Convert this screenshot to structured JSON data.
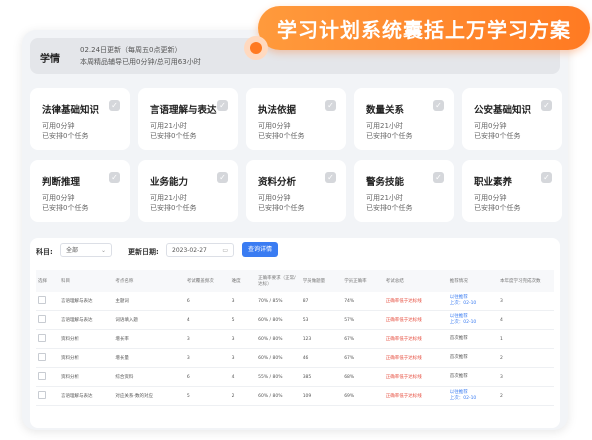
{
  "banner": {
    "text": "学习计划系统囊括上万学习方案"
  },
  "header": {
    "title": "学情",
    "line1": "02.24日更新（每周五0点更新）",
    "line2": "本周精品辅导已用0分钟/总可用63小时"
  },
  "cards": [
    {
      "name": "法律基础知识",
      "line1": "可用0分钟",
      "line2": "已安排0个任务"
    },
    {
      "name": "言语理解与表达",
      "line1": "可用21小时",
      "line2": "已安排0个任务"
    },
    {
      "name": "执法依据",
      "line1": "可用0分钟",
      "line2": "已安排0个任务"
    },
    {
      "name": "数量关系",
      "line1": "可用21小时",
      "line2": "已安排0个任务"
    },
    {
      "name": "公安基础知识",
      "line1": "可用0分钟",
      "line2": "已安排0个任务"
    },
    {
      "name": "判断推理",
      "line1": "可用0分钟",
      "line2": "已安排0个任务"
    },
    {
      "name": "业务能力",
      "line1": "可用21小时",
      "line2": "已安排0个任务"
    },
    {
      "name": "资料分析",
      "line1": "可用0分钟",
      "line2": "已安排0个任务"
    },
    {
      "name": "警务技能",
      "line1": "可用21小时",
      "line2": "已安排0个任务"
    },
    {
      "name": "职业素养",
      "line1": "可用0分钟",
      "line2": "已安排0个任务"
    }
  ],
  "filters": {
    "subject_label": "科目:",
    "subject_value": "全部",
    "date_label": "更新日期:",
    "date_value": "2023-02-27",
    "query_button": "查询详情"
  },
  "table": {
    "headers": [
      "选择",
      "科目",
      "考点名称",
      "考试覆盖频次",
      "难度",
      "正确率要求（正常/达标）",
      "学员做题量",
      "学员正确率",
      "考试总结",
      "推荐情况",
      "本年度学习完成次数"
    ],
    "rows": [
      {
        "subject": "言语理解与表达",
        "topic": "主题词",
        "freq": "6",
        "diff": "3",
        "req": "70% / 85%",
        "qty": "87",
        "acc": "74%",
        "summary": "正确率低于达标线",
        "rec": [
          "以往推荐",
          "上次：02-10"
        ],
        "times": "3"
      },
      {
        "subject": "言语理解与表达",
        "topic": "词语填入题",
        "freq": "4",
        "diff": "5",
        "req": "60% / 80%",
        "qty": "53",
        "acc": "57%",
        "summary": "正确率低于达标线",
        "rec": [
          "以往推荐",
          "上次：02-10"
        ],
        "times": "4"
      },
      {
        "subject": "资料分析",
        "topic": "增长率",
        "freq": "3",
        "diff": "3",
        "req": "60% / 80%",
        "qty": "123",
        "acc": "67%",
        "summary": "正确率低于达标线",
        "rec": [
          "首次推荐"
        ],
        "times": "1"
      },
      {
        "subject": "资料分析",
        "topic": "增长量",
        "freq": "3",
        "diff": "3",
        "req": "60% / 80%",
        "qty": "46",
        "acc": "67%",
        "summary": "正确率低于达标线",
        "rec": [
          "首次推荐"
        ],
        "times": "2"
      },
      {
        "subject": "资料分析",
        "topic": "综合资料",
        "freq": "6",
        "diff": "4",
        "req": "55% / 80%",
        "qty": "385",
        "acc": "68%",
        "summary": "正确率低于达标线",
        "rec": [
          "首次推荐"
        ],
        "times": "3"
      },
      {
        "subject": "言语理解与表达",
        "topic": "对应关系-数的对应",
        "freq": "5",
        "diff": "2",
        "req": "60% / 80%",
        "qty": "109",
        "acc": "69%",
        "summary": "正确率低于达标线",
        "rec": [
          "以往推荐",
          "上次：02-10"
        ],
        "times": "2"
      }
    ]
  }
}
